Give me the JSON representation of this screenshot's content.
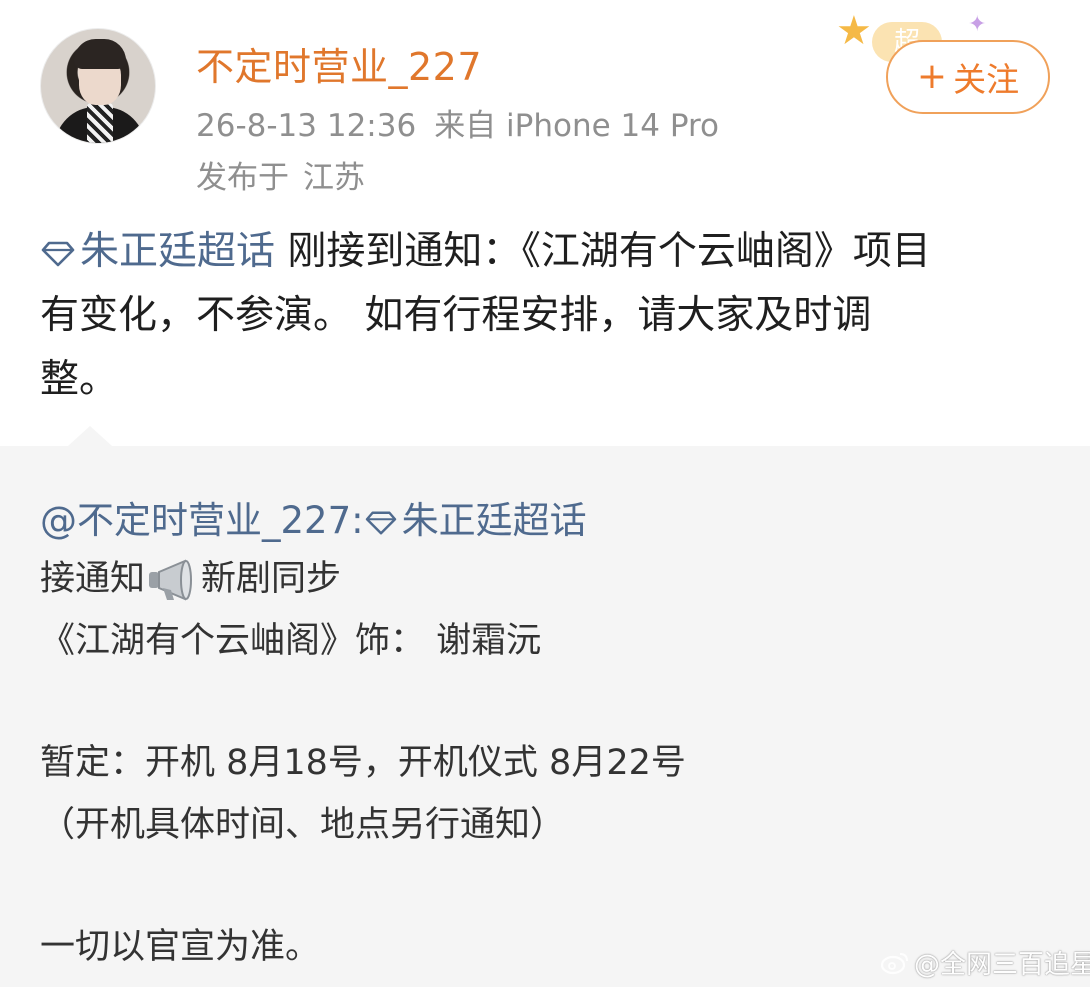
{
  "post": {
    "username": "不定时营业_227",
    "time": "26-8-13 12:36",
    "source": "来自 iPhone 14 Pro",
    "location_prefix": "发布于",
    "location": "江苏",
    "follow_label": "关注",
    "follow_icon": "plus-icon",
    "sticker_label": "超",
    "topic": "朱正廷超话",
    "body_line1": " 刚接到通知：《江湖有个云岫阁》项目",
    "body_line2": "有变化，不参演。 如有行程安排，请大家及时调",
    "body_line3": "整。"
  },
  "repost": {
    "author": "@不定时营业_227:",
    "topic": "朱正廷超话",
    "line1_a": "接通知",
    "line1_b": "新剧同步",
    "line2": "《江湖有个云岫阁》饰：  谢霜沅",
    "line3": "暂定：开机 8月18号，开机仪式 8月22号",
    "line4": "（开机具体时间、地点另行通知）",
    "line5": "一切以官宣为准。"
  },
  "watermark": {
    "text": "@全网三百追星人",
    "icon": "weibo-logo-icon"
  },
  "colors": {
    "username": "#e0772c",
    "topic": "#4f6a8e",
    "meta": "#8f8f8f",
    "follow_border": "#f0a15a",
    "repost_bg": "#f5f5f5"
  }
}
